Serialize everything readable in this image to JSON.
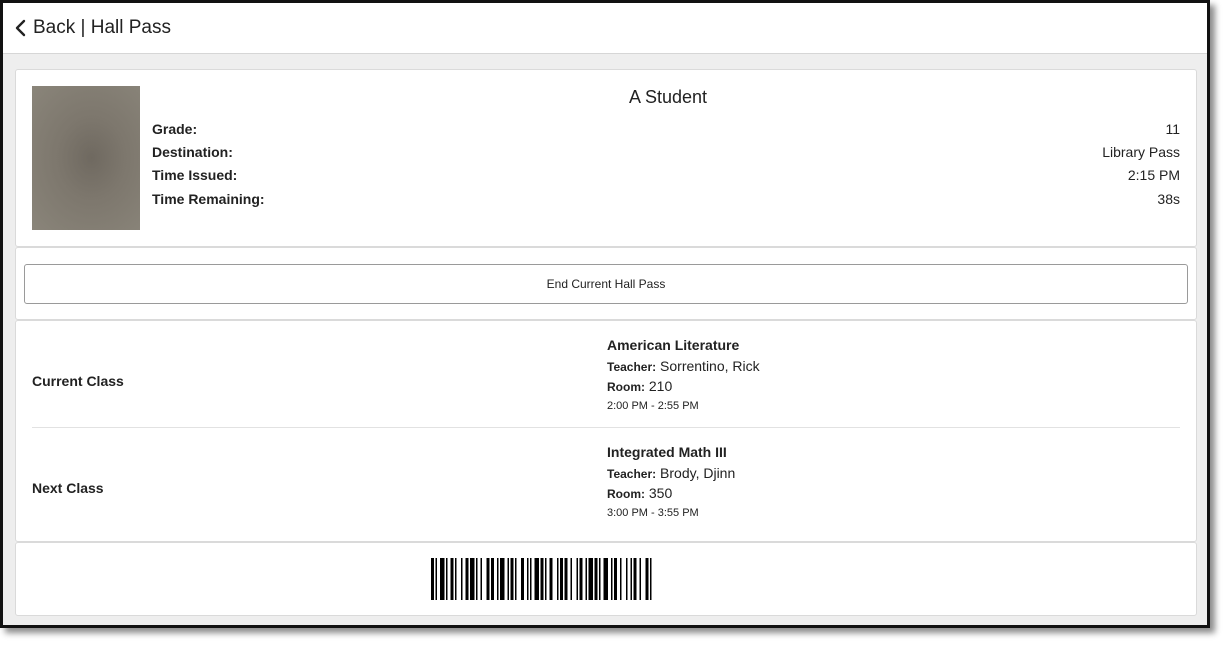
{
  "header": {
    "back_label": "Back | Hall Pass"
  },
  "student": {
    "name": "A Student",
    "fields": [
      {
        "label": "Grade:",
        "value": "11"
      },
      {
        "label": "Destination:",
        "value": "Library Pass"
      },
      {
        "label": "Time Issued:",
        "value": "2:15 PM"
      },
      {
        "label": "Time Remaining:",
        "value": "38s"
      }
    ]
  },
  "actions": {
    "end_pass_label": "End Current Hall Pass"
  },
  "classes": {
    "current": {
      "label": "Current Class",
      "course": "American Literature",
      "teacher_key": "Teacher:",
      "teacher": "Sorrentino, Rick",
      "room_key": "Room:",
      "room": "210",
      "time": "2:00 PM - 2:55 PM"
    },
    "next": {
      "label": "Next Class",
      "course": "Integrated Math III",
      "teacher_key": "Teacher:",
      "teacher": "Brody, Djinn",
      "room_key": "Room:",
      "room": "350",
      "time": "3:00 PM - 3:55 PM"
    }
  },
  "colors": {
    "background": "#eeeeee",
    "card": "#ffffff",
    "border": "#dadada",
    "text": "#222222"
  }
}
